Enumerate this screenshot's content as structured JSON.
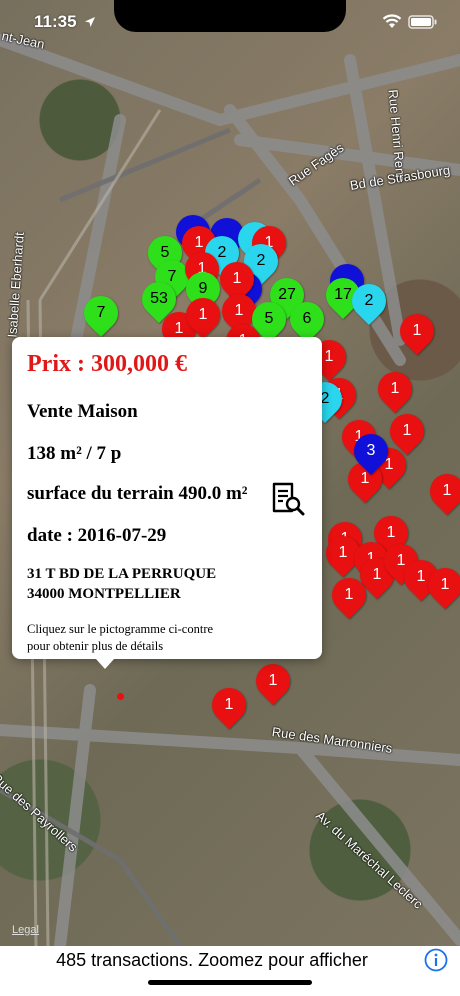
{
  "status_bar": {
    "time": "11:35"
  },
  "map": {
    "labels": {
      "street_top_left": "nt-Jean",
      "rue_fages": "Rue Fagès",
      "rue_henri_rene": "Rue Henri René",
      "bd_strasbourg": "Bd de Strasbourg",
      "isabelle_eberhardt": "Isabelle Eberhardt",
      "rue_marronniers": "Rue des Marronniers",
      "rue_payrollers": "Rue des Payrollers",
      "av_marechal_leclerc": "Av. du Maréchal Leclerc",
      "legal": "Legal"
    },
    "colors": {
      "red": "#e81010",
      "green": "#2ee01a",
      "cyan": "#29d6ee",
      "blue": "#1010d8"
    },
    "markers": [
      {
        "color": "blue",
        "label": ""
      },
      {
        "color": "blue",
        "label": ""
      },
      {
        "color": "red",
        "label": "1"
      },
      {
        "color": "cyan",
        "label": ""
      },
      {
        "color": "red",
        "label": "1"
      },
      {
        "color": "green",
        "label": "5"
      },
      {
        "color": "cyan",
        "label": "2"
      },
      {
        "color": "cyan",
        "label": "2"
      },
      {
        "color": "green",
        "label": "7"
      },
      {
        "color": "red",
        "label": "1"
      },
      {
        "color": "blue",
        "label": ""
      },
      {
        "color": "blue",
        "label": ""
      },
      {
        "color": "red",
        "label": "1"
      },
      {
        "color": "green",
        "label": "53"
      },
      {
        "color": "green",
        "label": "9"
      },
      {
        "color": "green",
        "label": "27"
      },
      {
        "color": "green",
        "label": "17"
      },
      {
        "color": "cyan",
        "label": "2"
      },
      {
        "color": "green",
        "label": "7"
      },
      {
        "color": "red",
        "label": "1"
      },
      {
        "color": "red",
        "label": "1"
      },
      {
        "color": "red",
        "label": "1"
      },
      {
        "color": "green",
        "label": "5"
      },
      {
        "color": "green",
        "label": "6"
      },
      {
        "color": "red",
        "label": "1"
      },
      {
        "color": "red",
        "label": "1"
      },
      {
        "color": "red",
        "label": "1"
      },
      {
        "color": "red",
        "label": "1"
      },
      {
        "color": "red",
        "label": "1"
      },
      {
        "color": "cyan",
        "label": "2"
      },
      {
        "color": "red",
        "label": "1"
      },
      {
        "color": "red",
        "label": "1"
      },
      {
        "color": "red",
        "label": "1"
      },
      {
        "color": "blue",
        "label": "3"
      },
      {
        "color": "red",
        "label": "1"
      },
      {
        "color": "red",
        "label": "1"
      },
      {
        "color": "red",
        "label": "1"
      },
      {
        "color": "red",
        "label": "1"
      },
      {
        "color": "red",
        "label": "1"
      },
      {
        "color": "red",
        "label": "1"
      },
      {
        "color": "red",
        "label": "1"
      },
      {
        "color": "red",
        "label": "1"
      },
      {
        "color": "red",
        "label": "1"
      },
      {
        "color": "red",
        "label": "1"
      },
      {
        "color": "red",
        "label": "1"
      },
      {
        "color": "red",
        "label": "1"
      },
      {
        "color": "red",
        "label": "1"
      },
      {
        "color": "red",
        "label": "1"
      }
    ]
  },
  "popup": {
    "price": "Prix : 300,000 €",
    "type": "Vente Maison",
    "surface": "138 m² / 7 p",
    "terrain": "surface du terrain 490.0 m²",
    "date": "date : 2016-07-29",
    "address_line1": "31 T BD DE LA PERRUQUE",
    "address_line2": "34000 MONTPELLIER",
    "hint_line1": "Cliquez sur le pictogramme ci-contre",
    "hint_line2": "pour obtenir plus de détails",
    "details_icon": "document-search-icon"
  },
  "bottom_bar": {
    "text": "485 transactions. Zoomez pour afficher",
    "info_icon": "info-icon"
  }
}
